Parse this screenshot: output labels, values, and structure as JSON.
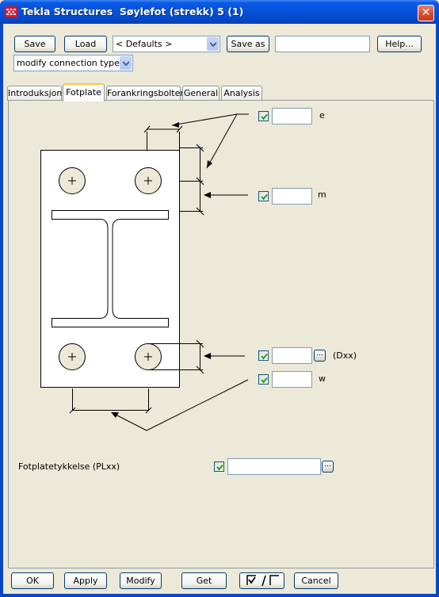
{
  "window": {
    "title": "Tekla Structures  Søylefot (strekk) 5 (1)",
    "close_label": "✕"
  },
  "toolbar": {
    "save_label": "Save",
    "load_label": "Load",
    "defaults_value": "< Defaults >",
    "save_as_label": "Save as",
    "save_as_value": "",
    "help_label": "Help...",
    "mode_value": "modify connection type"
  },
  "tabs": [
    {
      "label": "Introduksjon",
      "active": false
    },
    {
      "label": "Fotplate",
      "active": true
    },
    {
      "label": "Forankringsbolter",
      "active": false
    },
    {
      "label": "General",
      "active": false
    },
    {
      "label": "Analysis",
      "active": false
    }
  ],
  "fields": {
    "e": {
      "label": "e",
      "value": "",
      "checked": true
    },
    "m": {
      "label": "m",
      "value": "",
      "checked": true
    },
    "dxx": {
      "label": "(Dxx)",
      "value": "",
      "checked": true,
      "browse_label": "..."
    },
    "w": {
      "label": "w",
      "value": "",
      "checked": true
    },
    "plate_thickness": {
      "label": "Fotplatetykkelse (PLxx)",
      "value": "",
      "checked": true,
      "browse_label": "..."
    }
  },
  "footer": {
    "ok_label": "OK",
    "apply_label": "Apply",
    "modify_label": "Modify",
    "get_label": "Get",
    "toggle_label": "/",
    "cancel_label": "Cancel"
  }
}
